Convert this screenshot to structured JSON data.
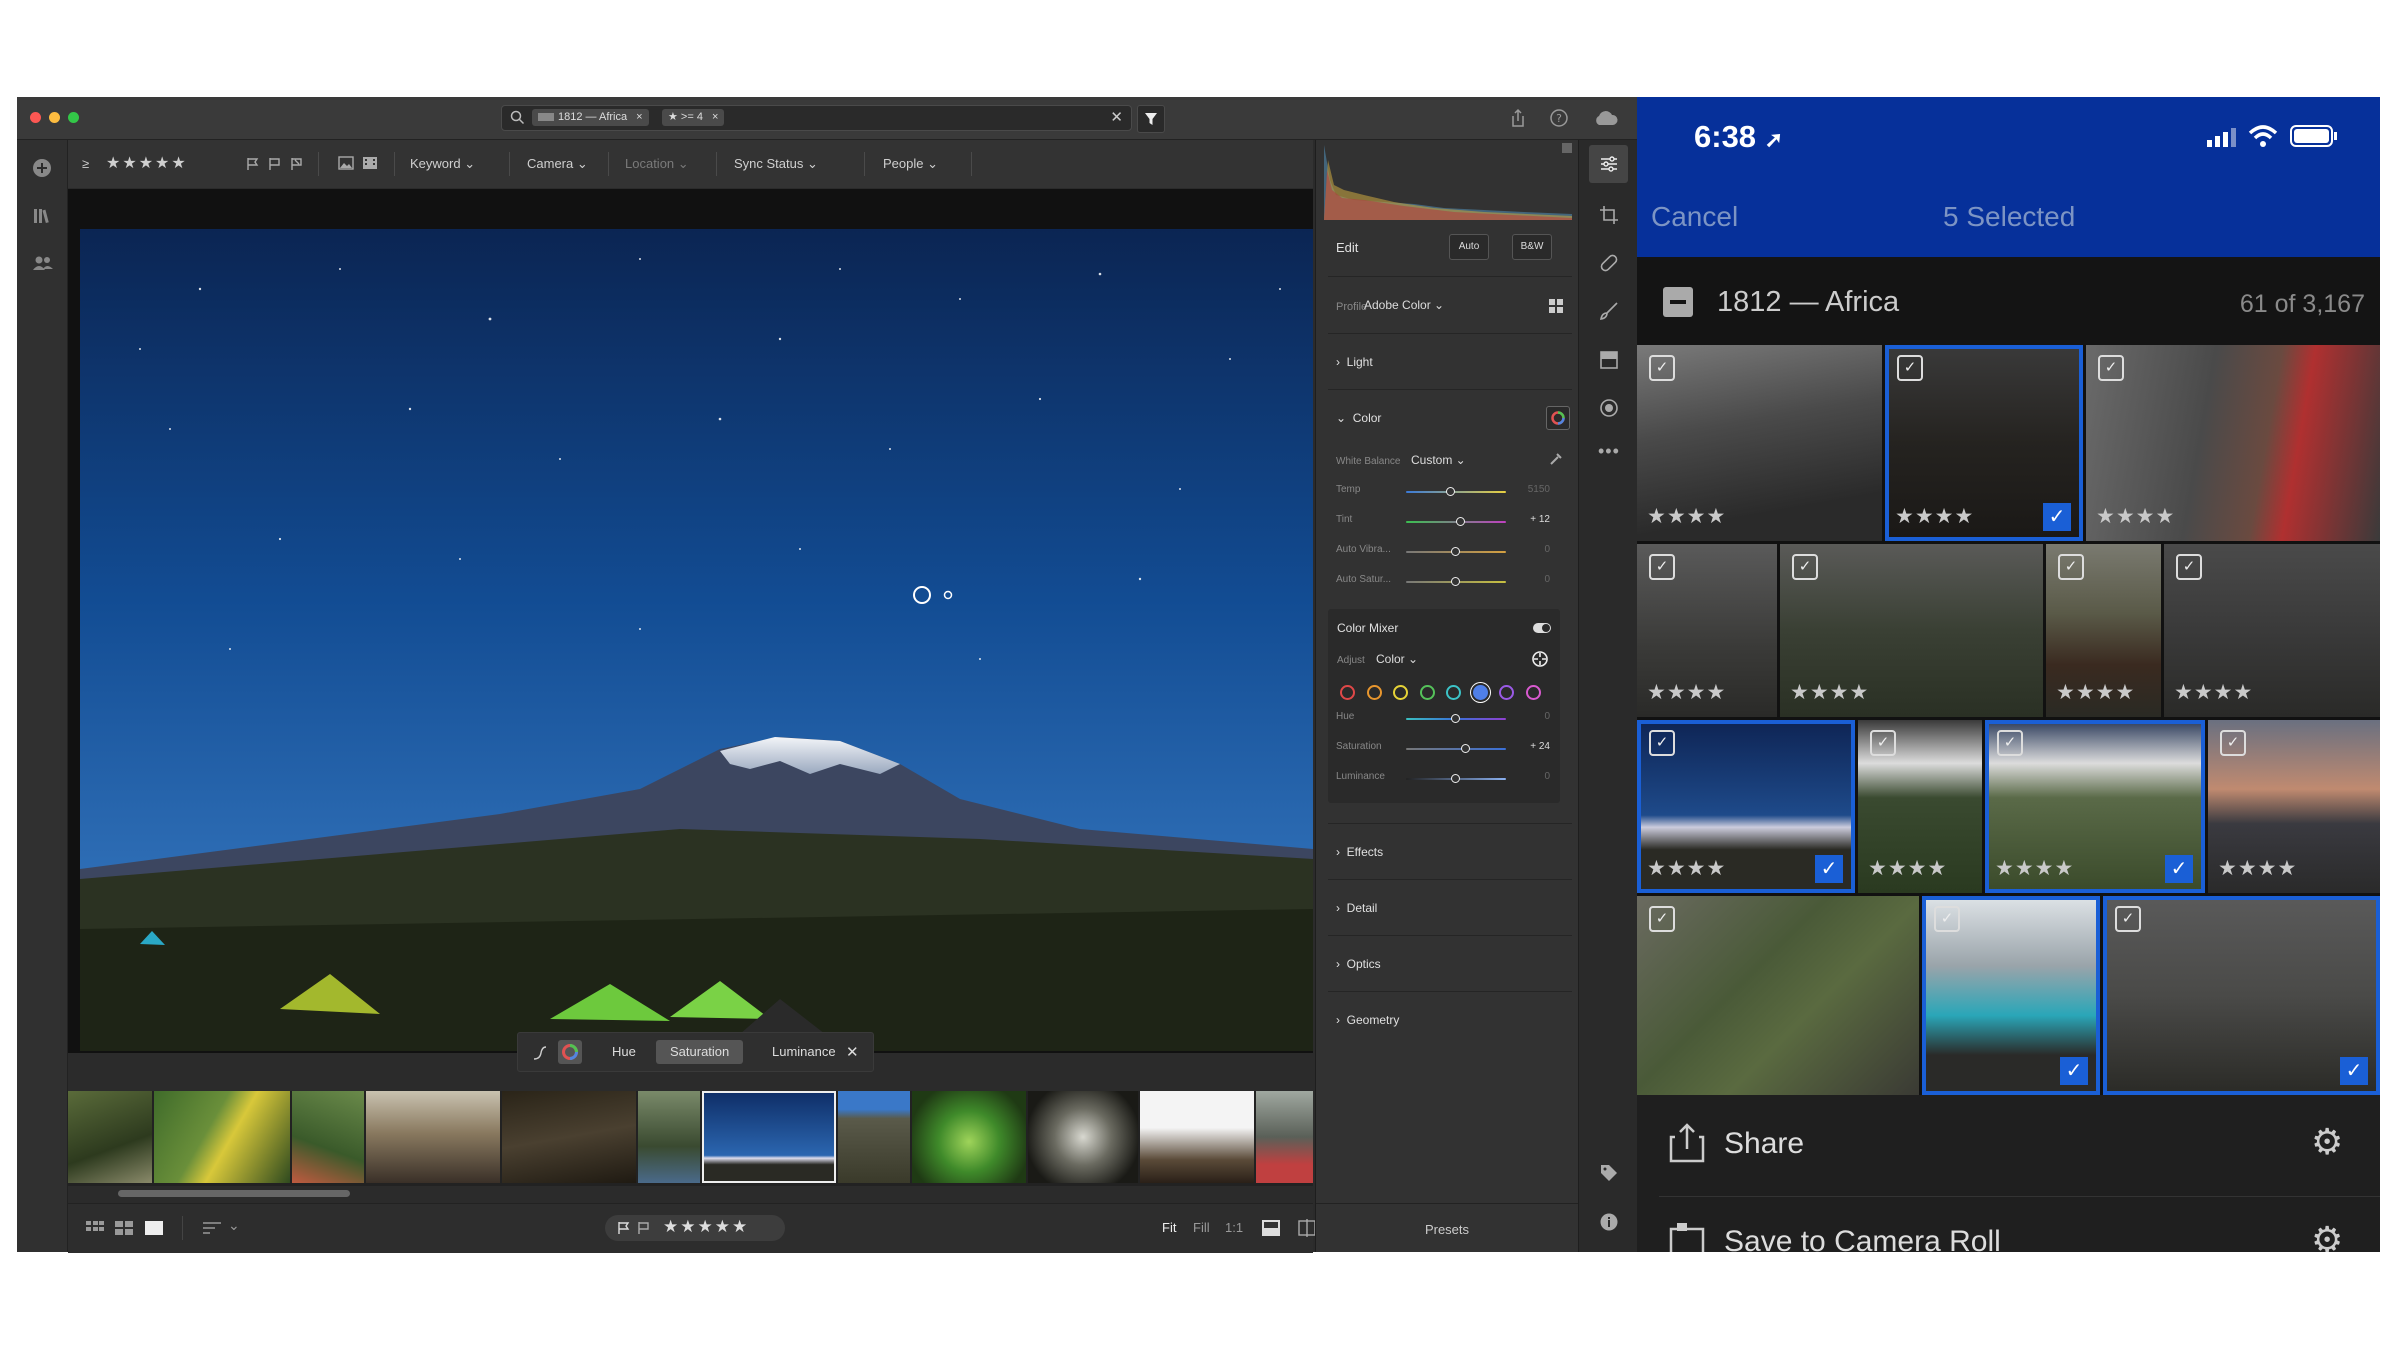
{
  "colors": {
    "accent": "#1a5fd6",
    "phone_header": "#06309a",
    "panel_bg": "#323232",
    "window_bg": "#2b2b2b"
  },
  "search": {
    "album_chip": "1812 — Africa",
    "rating_chip": "★ >= 4"
  },
  "filterbar": {
    "rating_prefix": "≥",
    "rating_stars": "★★★★★",
    "keyword": "Keyword",
    "camera": "Camera",
    "location": "Location",
    "sync_status": "Sync Status",
    "people": "People"
  },
  "hsl_tool": {
    "hue": "Hue",
    "saturation": "Saturation",
    "luminance": "Luminance",
    "close": "✕"
  },
  "bottom_bar": {
    "rating": "★★★★★",
    "fit": "Fit",
    "fill": "Fill",
    "one_to_one": "1:1"
  },
  "edit_panel": {
    "title": "Edit",
    "auto": "Auto",
    "bw": "B&W",
    "profile_label": "Profile",
    "profile_value": "Adobe Color",
    "light": "Light",
    "color": "Color",
    "white_balance_label": "White Balance",
    "white_balance_value": "Custom",
    "sliders": [
      {
        "label": "Temp",
        "value": "5150",
        "pos": 0.45
      },
      {
        "label": "Tint",
        "value": "+ 12",
        "pos": 0.55
      },
      {
        "label": "Auto Vibra...",
        "value": "0",
        "pos": 0.5
      },
      {
        "label": "Auto Satur...",
        "value": "0",
        "pos": 0.5
      }
    ],
    "color_mixer": "Color Mixer",
    "adjust_label": "Adjust",
    "adjust_value": "Color",
    "mixer_sliders": [
      {
        "label": "Hue",
        "value": "0",
        "pos": 0.5
      },
      {
        "label": "Saturation",
        "value": "+ 24",
        "pos": 0.6
      },
      {
        "label": "Luminance",
        "value": "0",
        "pos": 0.5
      }
    ],
    "swatch_colors": [
      "#e04848",
      "#e8962e",
      "#e6d337",
      "#55c25a",
      "#3cc3c7",
      "#4f7fe8",
      "#9a5ae6",
      "#d95ad0"
    ],
    "effects": "Effects",
    "detail": "Detail",
    "optics": "Optics",
    "geometry": "Geometry",
    "presets": "Presets"
  },
  "phone": {
    "time": "6:38",
    "cancel": "Cancel",
    "selected": "5 Selected",
    "album": "1812 — Africa",
    "count": "61 of 3,167",
    "tile_stars": "★★★★",
    "share": "Share",
    "save": "Save to Camera Roll"
  }
}
